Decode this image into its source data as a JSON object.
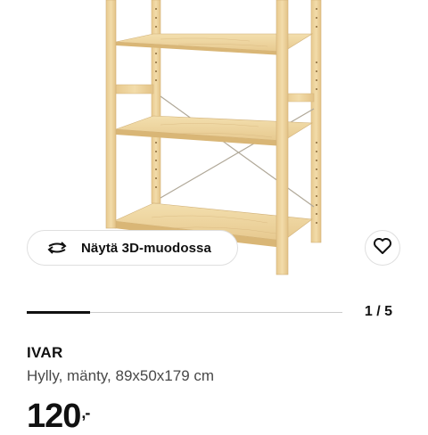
{
  "product": {
    "view3d_label": "Näytä 3D-muodossa",
    "view3d_icon": "rotate-3d-icon",
    "favorite_icon": "heart-icon",
    "name": "IVAR",
    "description": "Hylly, mänty, 89x50x179 cm",
    "price_whole": "120",
    "price_decimal": ",-"
  },
  "gallery": {
    "pager_text": "1 / 5",
    "current": 1,
    "total": 5,
    "progress_fraction": 0.2
  },
  "colors": {
    "pine_wood": "#ecd09a",
    "text": "#111111",
    "muted_text": "#484848",
    "border": "#dfdfdf"
  }
}
